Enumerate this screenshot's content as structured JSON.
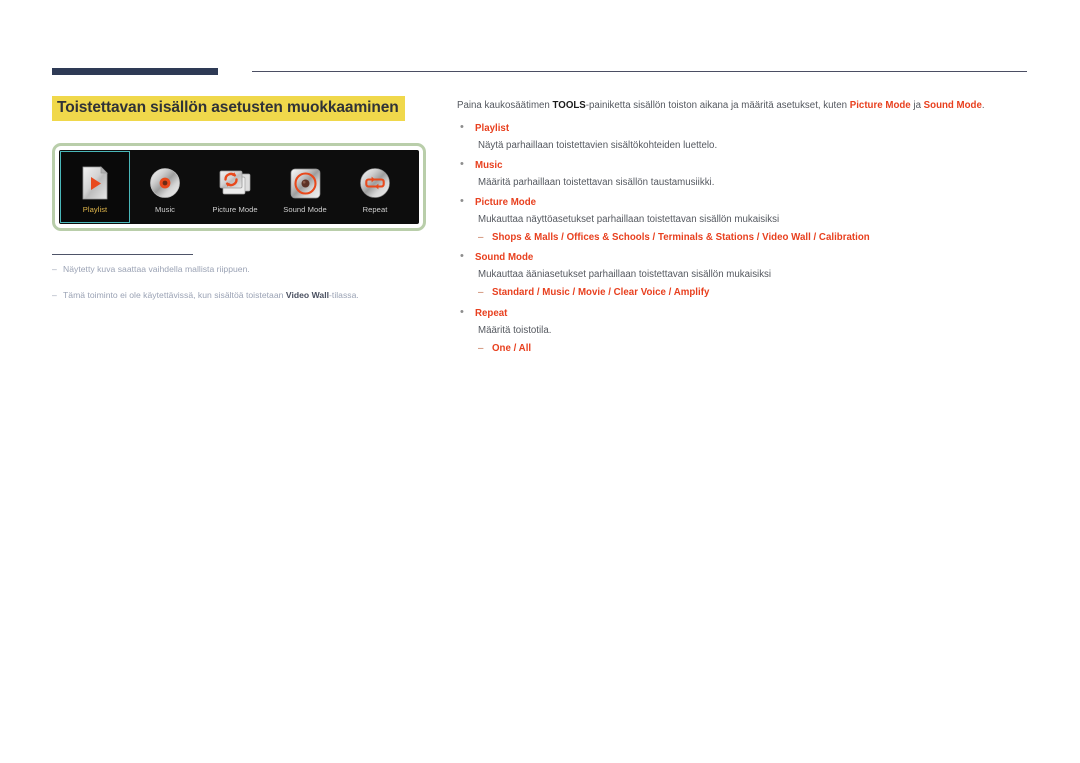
{
  "page": {
    "title": "Toistettavan sisällön asetusten muokkaaminen"
  },
  "device_panel": {
    "items": [
      {
        "label": "Playlist",
        "icon": "playlist-document-play-icon",
        "selected": true
      },
      {
        "label": "Music",
        "icon": "music-disc-icon",
        "selected": false
      },
      {
        "label": "Picture Mode",
        "icon": "picture-mode-cards-refresh-icon",
        "selected": false
      },
      {
        "label": "Sound Mode",
        "icon": "sound-mode-speaker-icon",
        "selected": false
      },
      {
        "label": "Repeat",
        "icon": "repeat-loop-icon",
        "selected": false
      }
    ]
  },
  "footnotes": [
    {
      "dash": "–",
      "text_before": "Näytetty kuva saattaa vaihdella mallista riippuen.",
      "bold": "",
      "text_after": ""
    },
    {
      "dash": "–",
      "text_before": "Tämä toiminto ei ole käytettävissä, kun sisältöä toistetaan ",
      "bold": "Video Wall",
      "text_after": "-tilassa."
    }
  ],
  "intro": {
    "p1": "Paina kaukosäätimen ",
    "key": "TOOLS",
    "p2": "-painiketta sisällön toiston aikana ja määritä asetukset, kuten ",
    "ref1": "Picture Mode",
    "p3": " ja ",
    "ref2": "Sound Mode",
    "p4": "."
  },
  "sections": [
    {
      "bullet": "•",
      "heading": "Playlist",
      "desc": "Näytä parhaillaan toistettavien sisältökohteiden luettelo.",
      "sub": null
    },
    {
      "bullet": "•",
      "heading": "Music",
      "desc": "Määritä parhaillaan toistettavan sisällön taustamusiikki.",
      "sub": null
    },
    {
      "bullet": "•",
      "heading": "Picture Mode",
      "desc": "Mukauttaa näyttöasetukset parhaillaan toistettavan sisällön mukaisiksi",
      "sub": {
        "dash": "–",
        "text": "Shops & Malls / Offices & Schools / Terminals & Stations / Video Wall / Calibration"
      }
    },
    {
      "bullet": "•",
      "heading": "Sound Mode",
      "desc": "Mukauttaa ääniasetukset parhaillaan toistettavan sisällön mukaisiksi",
      "sub": {
        "dash": "–",
        "text": "Standard / Music / Movie / Clear Voice / Amplify"
      }
    },
    {
      "bullet": "•",
      "heading": "Repeat",
      "desc": "Määritä toistotila.",
      "sub": {
        "dash": "–",
        "text": "One / All"
      }
    }
  ],
  "colors": {
    "accent_red": "#e8401f",
    "highlight_yellow": "#f0d84b",
    "rule_navy": "#2e3a55",
    "panel_border_green": "#b9ceaa",
    "selection_teal": "#49b6b8",
    "label_gold": "#e0b64a",
    "footnote_gray": "#9aa2b4",
    "body_gray": "#54585f"
  }
}
